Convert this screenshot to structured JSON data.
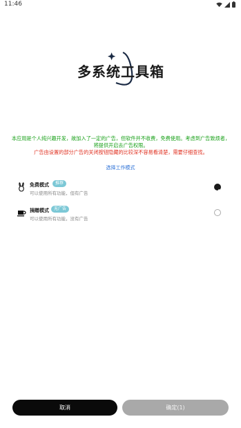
{
  "status_bar": {
    "time": "11:46"
  },
  "logo": {
    "text": "多系统工具箱"
  },
  "notice": {
    "line1": "本应用是个人纯兴趣开发，故加入了一定的广告，但软件并不收费，免费使用。考虑到广告致烦者，将提供开启去广告权限。",
    "line2": "广告由设置的部分广告的关闭按钮隐藏的比较深不容易看清楚，需要仔细查找。"
  },
  "mode_section": {
    "title": "选择工作模式"
  },
  "modes": [
    {
      "name": "免费模式",
      "tag": "推荐",
      "desc": "可以使用所有功能，但有广告",
      "selected": true,
      "icon": "rabbit-icon"
    },
    {
      "name": "捐赠模式",
      "tag": "无广告",
      "desc": "可以使用所有功能，没有广告",
      "selected": false,
      "icon": "coffee-icon"
    }
  ],
  "buttons": {
    "cancel": "取消",
    "confirm": "确定(1)"
  },
  "colors": {
    "accent_green": "#1aa11a",
    "accent_red": "#e03020",
    "link_blue": "#2a6fd6",
    "tag_teal": "#7cc8d6"
  }
}
